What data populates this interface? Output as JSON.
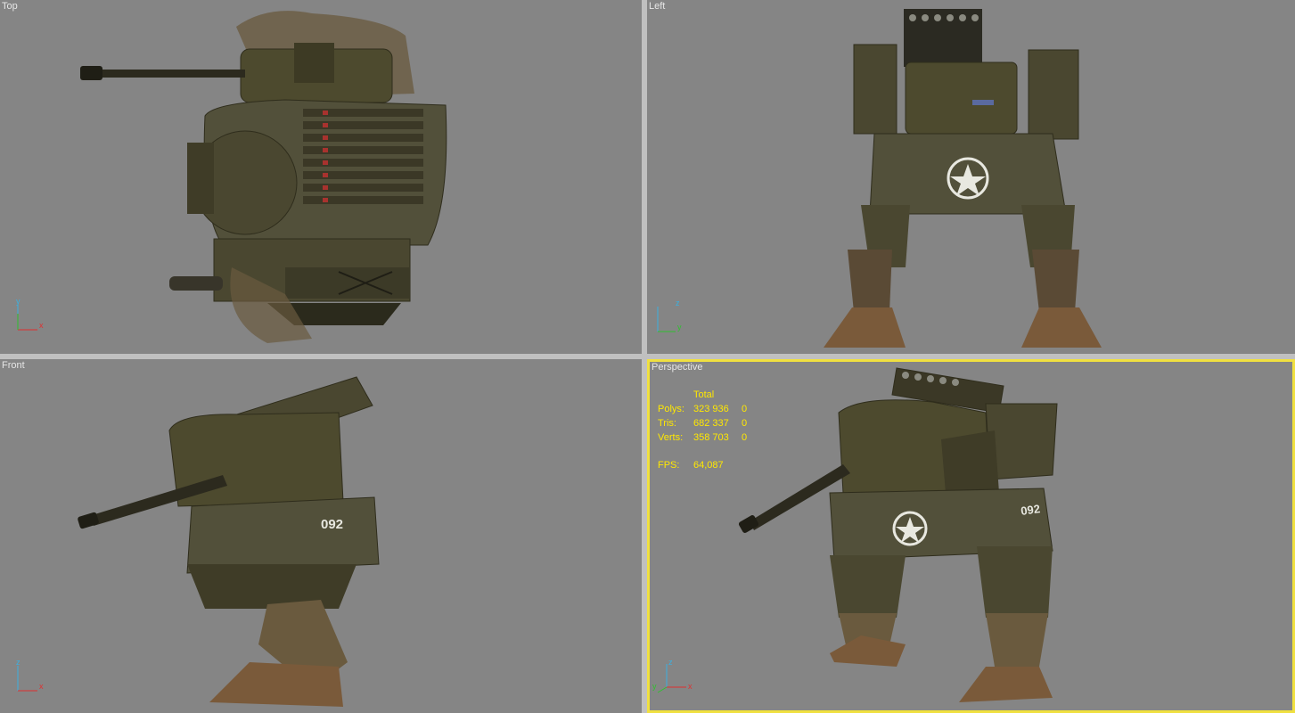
{
  "viewports": {
    "top": {
      "label": "Top",
      "axes": [
        "y",
        "x"
      ]
    },
    "left": {
      "label": "Left",
      "axes": [
        "z",
        "y"
      ]
    },
    "front": {
      "label": "Front",
      "axes": [
        "z",
        "x"
      ]
    },
    "perspective": {
      "label": "Perspective",
      "axes": [
        "z",
        "y",
        "x"
      ],
      "active": true
    }
  },
  "stats": {
    "header": "Total",
    "rows": [
      {
        "label": "Polys:",
        "total": "323 936",
        "selected": "0"
      },
      {
        "label": "Tris:",
        "total": "682 337",
        "selected": "0"
      },
      {
        "label": "Verts:",
        "total": "358 703",
        "selected": "0"
      }
    ],
    "fps_label": "FPS:",
    "fps_value": "64,087"
  },
  "model": {
    "hull_number": "092"
  },
  "colors": {
    "viewport_bg": "#858585",
    "active_border": "#f0e040",
    "stats_text": "#ffe800",
    "hull": "#4d4a2e",
    "hull_dark": "#2f2d1c",
    "rust": "#7a5a3a"
  }
}
